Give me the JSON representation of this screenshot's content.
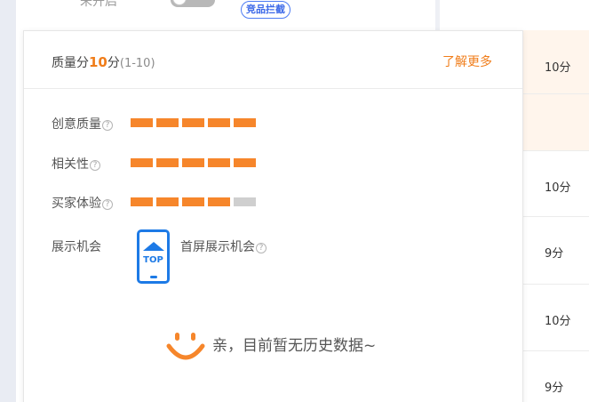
{
  "background": {
    "status_label": "未开启",
    "tag_label": "竞品拦截"
  },
  "score_column": {
    "cells": [
      "10分",
      "",
      "10分",
      "9分",
      "10分",
      "9分"
    ]
  },
  "popover": {
    "title_prefix": "质量分",
    "score": "10",
    "score_unit": "分",
    "score_range": "(1-10)",
    "learn_more": "了解更多",
    "metrics": [
      {
        "label": "创意质量",
        "level": 5,
        "max": 5
      },
      {
        "label": "相关性",
        "level": 5,
        "max": 5
      },
      {
        "label": "买家体验",
        "level": 4,
        "max": 5
      }
    ],
    "exposure_label": "展示机会",
    "phone_icon_text": "TOP",
    "exposure_value": "首屏展示机会",
    "empty_message": "亲，目前暂无历史数据~"
  },
  "colors": {
    "accent": "#f07d1a",
    "bar_on": "#f6862b",
    "bar_off": "#cfcfcf",
    "phone_blue": "#1d7ae6",
    "highlight_row": "#fff5ec"
  }
}
